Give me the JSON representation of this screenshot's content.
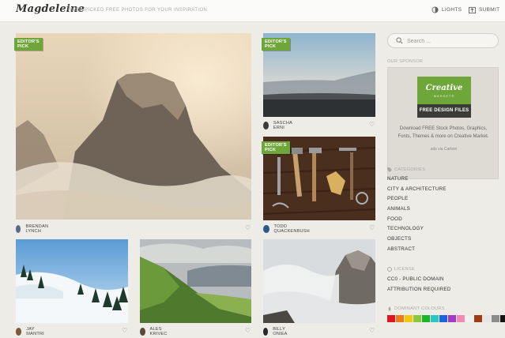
{
  "header": {
    "logo": "Magdeleine",
    "tagline": "HAND-PICKED FREE PHOTOS FOR YOUR INSPIRATION",
    "lights_label": "LIGHTS",
    "submit_label": "SUBMIT"
  },
  "photos": [
    {
      "badge": "EDITOR'S PICK",
      "author": "BRENDAN LYNCH",
      "subject": "mountain in fog"
    },
    {
      "badge": "EDITOR'S PICK",
      "author": "SASCHA ERNI",
      "subject": "misty landscape"
    },
    {
      "badge": "EDITOR'S PICK",
      "author": "TODD QUACKENBUSH",
      "subject": "tools on wood"
    },
    {
      "badge": "",
      "author": "JAY MANTRI",
      "subject": "snowy hill"
    },
    {
      "badge": "",
      "author": "ALES KRIVEC",
      "subject": "green mountain ridge"
    },
    {
      "badge": "",
      "author": "BILLY ONIEA",
      "subject": "rock in clouds"
    }
  ],
  "sidebar": {
    "search_placeholder": "Search ...",
    "sponsor_heading": "OUR SPONSOR",
    "sponsor_brand": "Creative",
    "sponsor_brand_sub": "MARKET®",
    "sponsor_cta": "FREE DESIGN FILES",
    "sponsor_text": "Download FREE Stock Photos, Graphics, Fonts, Themes & more on Creative Market.",
    "sponsor_via": "ads via Carbon",
    "categories_heading": "CATEGORIES",
    "categories": [
      "NATURE",
      "CITY & ARCHITECTURE",
      "PEOPLE",
      "ANIMALS",
      "FOOD",
      "TECHNOLOGY",
      "OBJECTS",
      "ABSTRACT"
    ],
    "license_heading": "LICENSE",
    "licenses": [
      "CC0 - PUBLIC DOMAIN",
      "ATTRIBUTION REQUIRED"
    ],
    "colours_heading": "DOMINANT COLOURS",
    "colours": [
      "#e0141e",
      "#f07a14",
      "#f0c814",
      "#8cc83c",
      "#1eb428",
      "#28c8c8",
      "#1e64dc",
      "#a03cc8",
      "#f08cb4",
      "#f0f0f0",
      "#a03c14",
      "#e6e6e6",
      "#8c8c8c",
      "#141414",
      "#ffffff"
    ]
  },
  "icons": {
    "lights": "lightbulb-icon",
    "submit": "upload-icon",
    "heart": "heart-icon",
    "search": "search-icon"
  }
}
